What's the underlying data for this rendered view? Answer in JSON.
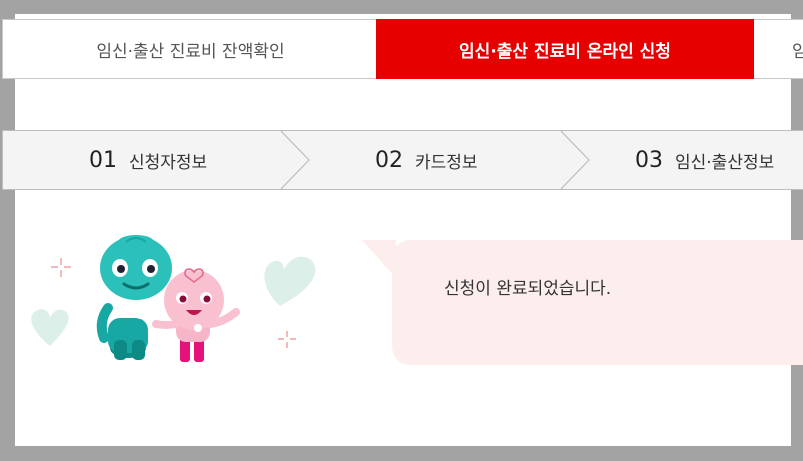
{
  "tabs": [
    {
      "label": "임신·출산 진료비 잔액확인",
      "active": false
    },
    {
      "label": "임신·출산 진료비 온라인 신청",
      "active": true
    },
    {
      "label": "임",
      "active": false
    }
  ],
  "steps": [
    {
      "num": "01",
      "label": "신청자정보"
    },
    {
      "num": "02",
      "label": "카드정보"
    },
    {
      "num": "03",
      "label": "임신·출산정보"
    }
  ],
  "message": {
    "text": "신청이 완료되었습니다."
  },
  "colors": {
    "accent": "#e60000",
    "bubble": "#fdeeee",
    "overlay": "#a3a3a3"
  },
  "icons": {
    "mascot": "mascot-illustration",
    "heart": "heart-icon",
    "sparkle": "sparkle-icon"
  }
}
